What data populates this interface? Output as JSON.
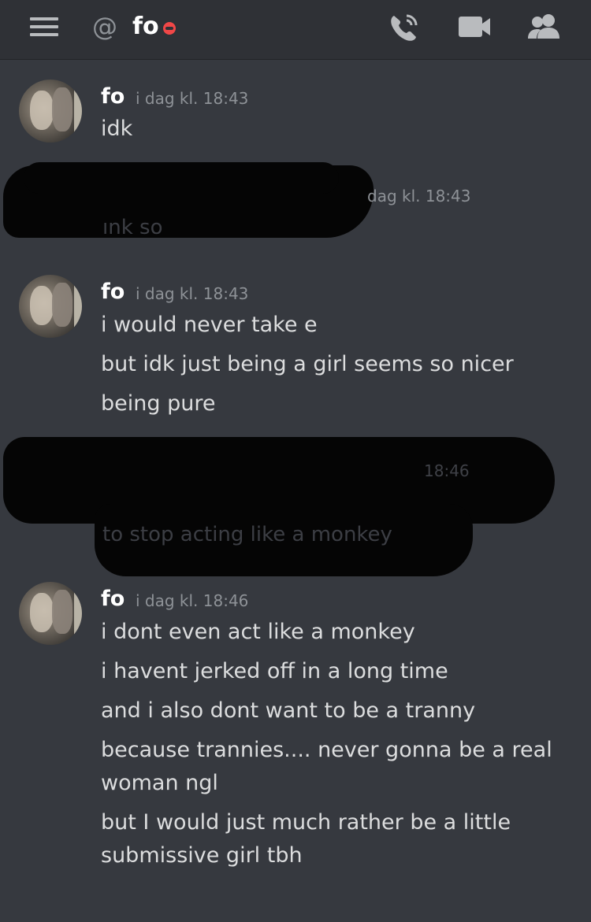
{
  "header": {
    "at_symbol": "@",
    "dm_name": "fo",
    "status": "do-not-disturb",
    "icons": [
      "menu-icon",
      "phone-call-icon",
      "video-call-icon",
      "members-icon"
    ]
  },
  "messages": [
    {
      "username": "fo",
      "timestamp": "i dag kl. 18:43",
      "lines": [
        "idk"
      ]
    },
    {
      "timestamp": "dag kl. 18:43",
      "redacted": true
    },
    {
      "username": "fo",
      "timestamp": "i dag kl. 18:43",
      "lines": [
        "i would never take e",
        "but idk just being a girl seems so nicer",
        "being pure"
      ]
    },
    {
      "timestamp": "18:46",
      "redacted": true
    },
    {
      "username": "fo",
      "timestamp": "i dag kl. 18:46",
      "lines": [
        "i dont even act like a monkey",
        "i havent jerked off in a long time",
        "and i also dont want to be a tranny",
        "because trannies.... never gonna be a real",
        "woman ngl",
        "but I would just much rather be a little",
        "submissive girl tbh"
      ]
    }
  ],
  "colors": {
    "background": "#36393f",
    "header_bg": "#2f3136",
    "status_dnd": "#f04747"
  }
}
